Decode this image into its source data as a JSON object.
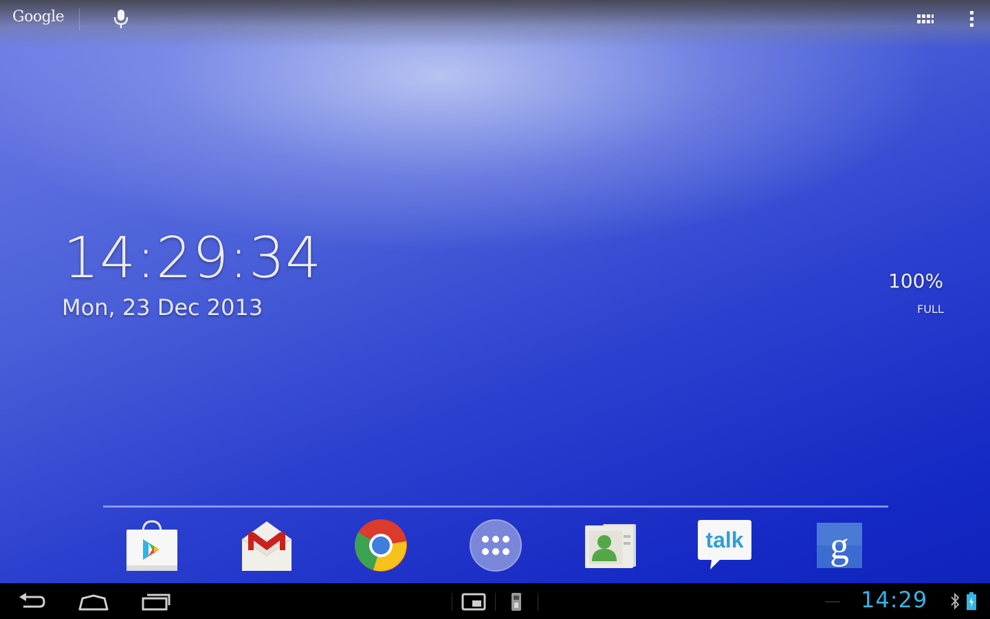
{
  "search_bar": {
    "logo_text": "Google",
    "mic_icon": "microphone-icon",
    "apps_icon": "all-apps-grid-icon",
    "overflow_icon": "overflow-menu-icon"
  },
  "clock_widget": {
    "time": "14:29:34",
    "date": "Mon, 23 Dec 2013"
  },
  "battery_widget": {
    "percent": "100%",
    "state": "FULL"
  },
  "dock": {
    "items": [
      {
        "icon": "play-store-icon"
      },
      {
        "icon": "gmail-icon"
      },
      {
        "icon": "chrome-icon"
      },
      {
        "icon": "app-drawer-icon"
      },
      {
        "icon": "contacts-icon"
      },
      {
        "icon": "talk-icon",
        "label": "talk"
      },
      {
        "icon": "google-search-app-icon",
        "label": "g"
      }
    ]
  },
  "nav_bar": {
    "back_icon": "back-icon",
    "home_icon": "home-icon",
    "recents_icon": "recent-apps-icon",
    "screenshot_icon": "screen-icon",
    "usb_icon": "usb-notification-icon"
  },
  "status": {
    "time": "14:29",
    "bluetooth_icon": "bluetooth-icon",
    "battery_icon": "battery-icon"
  },
  "colors": {
    "status_time": "#33b5e5",
    "wallpaper_blue": "#1428c4",
    "nav_bg": "#000000"
  }
}
